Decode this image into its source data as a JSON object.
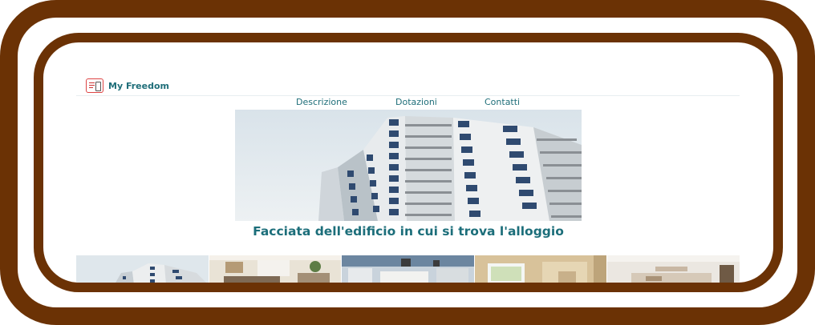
{
  "brand": {
    "name": "My Freedom",
    "logo_icon": "phone-listing-logo-icon"
  },
  "nav": [
    {
      "label": "Descrizione"
    },
    {
      "label": "Dotazioni"
    },
    {
      "label": "Contatti"
    }
  ],
  "hero": {
    "caption": "Facciata dell'edificio in cui si trova l'alloggio"
  },
  "gallery": {
    "thumbnails": [
      "building-facade",
      "living-room",
      "kitchen",
      "bathroom-window",
      "bedroom"
    ]
  },
  "colors": {
    "frame": "#6b3205",
    "accent": "#1f6e79"
  }
}
